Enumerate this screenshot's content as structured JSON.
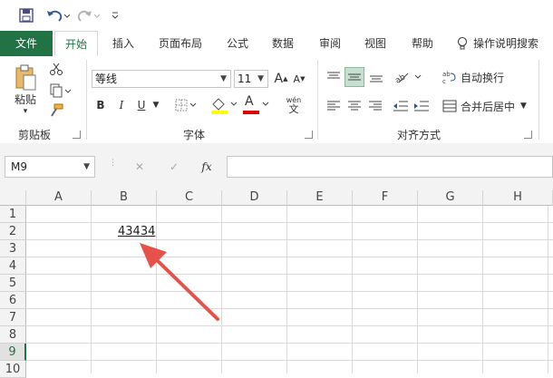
{
  "qat": {
    "save_icon": "save-icon",
    "undo_icon": "undo-icon",
    "redo_icon": "redo-icon",
    "customize_icon": "customize-icon"
  },
  "tabs": [
    {
      "label": "文件"
    },
    {
      "label": "开始"
    },
    {
      "label": "插入"
    },
    {
      "label": "页面布局"
    },
    {
      "label": "公式"
    },
    {
      "label": "数据"
    },
    {
      "label": "审阅"
    },
    {
      "label": "视图"
    },
    {
      "label": "帮助"
    }
  ],
  "tell_me": "操作说明搜索",
  "clipboard": {
    "paste_label": "粘贴",
    "group_label": "剪贴板"
  },
  "font": {
    "name": "等线",
    "size": "11",
    "bold": "B",
    "italic": "I",
    "underline": "U",
    "font_color_glyph": "A",
    "wen_top": "wén",
    "wen_bottom": "文",
    "grow": "A",
    "shrink": "A",
    "group_label": "字体"
  },
  "alignment": {
    "wrap_text": "自动换行",
    "merge_center": "合并后居中",
    "group_label": "对齐方式"
  },
  "formula_bar": {
    "name_box": "M9",
    "fx": "fx",
    "cancel": "✕",
    "enter": "✓",
    "value": ""
  },
  "sheet": {
    "columns": [
      "A",
      "B",
      "C",
      "D",
      "E",
      "F",
      "G",
      "H"
    ],
    "rows": [
      "1",
      "2",
      "3",
      "4",
      "5",
      "6",
      "7",
      "8",
      "9",
      "10"
    ],
    "selected_row": "9",
    "cells": {
      "B2": "43434"
    }
  },
  "colors": {
    "accent": "#217346",
    "highlight_yellow": "#ffff00",
    "font_red": "#e00000",
    "annotation_arrow": "#e8504a",
    "active_align": "#c6dfd0"
  }
}
